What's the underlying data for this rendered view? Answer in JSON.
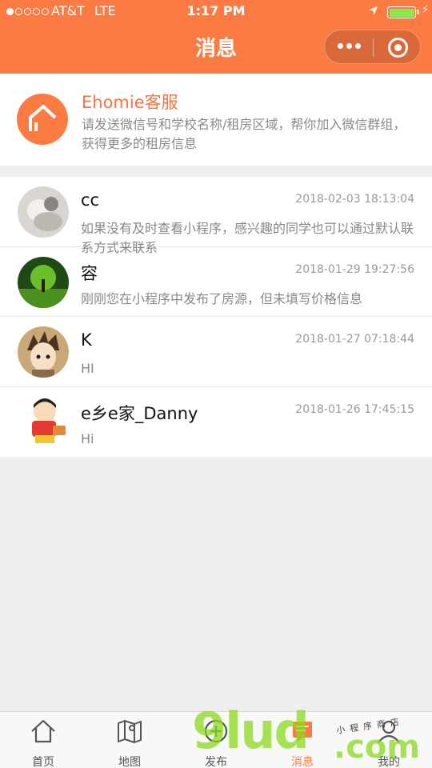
{
  "status_bar": {
    "carrier": "AT&T",
    "network": "LTE",
    "time": "1:17 PM"
  },
  "header": {
    "title": "消息"
  },
  "service": {
    "name": "Ehomie客服",
    "description": "请发送微信号和学校名称/租房区域，帮你加入微信群组，获得更多的租房信息"
  },
  "conversations": [
    {
      "name": "cc",
      "time": "2018-02-03 18:13:04",
      "message": "如果没有及时查看小程序，感兴趣的同学也可以通过默认联系方式来联系"
    },
    {
      "name": "容",
      "time": "2018-01-29 19:27:56",
      "message": "刚刚您在小程序中发布了房源，但未填写价格信息"
    },
    {
      "name": "K",
      "time": "2018-01-27 07:18:44",
      "message": "HI"
    },
    {
      "name": "e乡e家_Danny",
      "time": "2018-01-26 17:45:15",
      "message": "Hi"
    }
  ],
  "tabbar": {
    "active_color": "#fb7b42",
    "tabs": [
      {
        "label": "首页",
        "icon": "home-icon"
      },
      {
        "label": "地图",
        "icon": "map-icon"
      },
      {
        "label": "发布",
        "icon": "add-icon"
      },
      {
        "label": "消息",
        "icon": "message-icon"
      },
      {
        "label": "我的",
        "icon": "user-icon"
      }
    ]
  },
  "watermark": {
    "brand": "9lud",
    "domain": ".com",
    "tagline": "小程序商店"
  },
  "colors": {
    "accent": "#fb7b42",
    "service_name": "#f27546"
  }
}
